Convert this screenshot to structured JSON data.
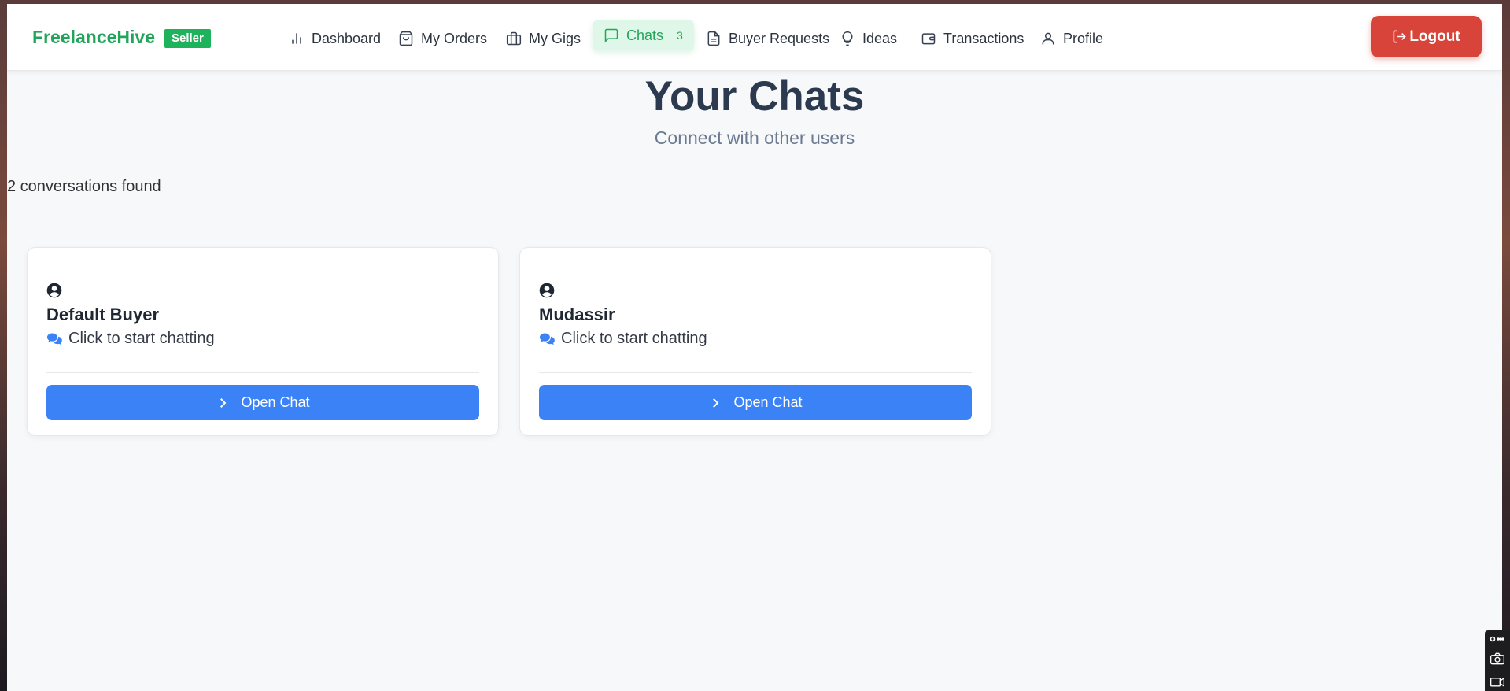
{
  "app": {
    "brand": "FreelanceHive",
    "role_badge": "Seller"
  },
  "nav": {
    "items": [
      {
        "label": "Dashboard",
        "icon": "bar-chart-icon"
      },
      {
        "label": "My Orders",
        "icon": "shopping-bag-icon"
      },
      {
        "label": "My Gigs",
        "icon": "briefcase-icon"
      },
      {
        "label": "Chats",
        "icon": "message-square-icon",
        "count": "3",
        "active": true
      },
      {
        "label": "Buyer Requests",
        "icon": "file-text-icon"
      },
      {
        "label": "Ideas",
        "icon": "lightbulb-icon"
      },
      {
        "label": "Transactions",
        "icon": "wallet-icon"
      },
      {
        "label": "Profile",
        "icon": "user-icon"
      }
    ],
    "logout_label": "Logout"
  },
  "page": {
    "title": "Your Chats",
    "subtitle": "Connect with other users",
    "count_text": "2 conversations found"
  },
  "chats": [
    {
      "name": "Default Buyer",
      "subtitle": "Click to start chatting",
      "button": "Open Chat"
    },
    {
      "name": "Mudassir",
      "subtitle": "Click to start chatting",
      "button": "Open Chat"
    }
  ],
  "colors": {
    "brand_green": "#22a55a",
    "logout_red": "#d8443a",
    "primary_blue": "#3b82f6",
    "page_bg": "#f7f8fa"
  }
}
